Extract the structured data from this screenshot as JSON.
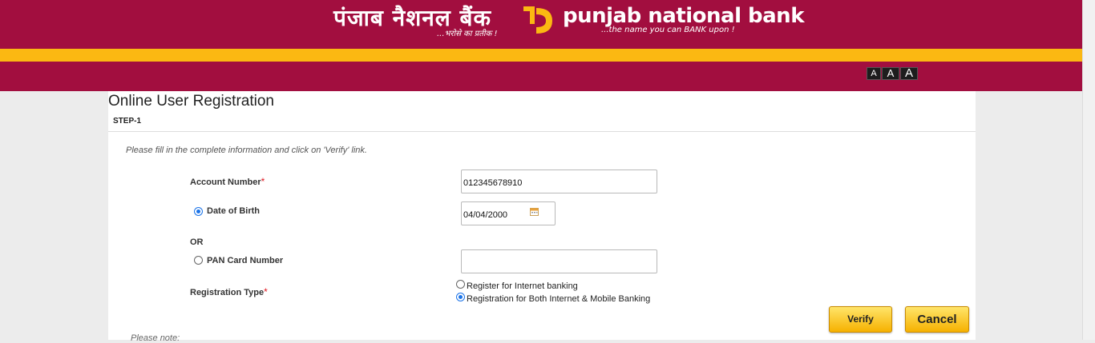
{
  "header": {
    "hindi_name": "पंजाब नैशनल बैंक",
    "hindi_tagline": "...भरोसे का प्रतीक !",
    "english_name": "punjab national bank",
    "english_tagline": "...the name you can BANK upon !",
    "font_sizer": [
      "A",
      "A",
      "A"
    ]
  },
  "page": {
    "title": "Online User Registration",
    "step": "STEP-1",
    "instructions": "Please fill in the complete information and click on 'Verify' link."
  },
  "form": {
    "account_number_label": "Account Number",
    "required_mark": "*",
    "account_number_value": "012345678910",
    "dob_label": "Date of Birth",
    "dob_value": "04/04/2000",
    "or_label": "OR",
    "pan_label": "PAN Card Number",
    "pan_value": "",
    "registration_type_label": "Registration Type",
    "registration_options": [
      "Register for Internet banking",
      "Registration for Both Internet & Mobile Banking"
    ],
    "selected_registration_option": 1,
    "selected_identity_option": "dob"
  },
  "buttons": {
    "verify": "Verify",
    "cancel": "Cancel"
  },
  "footer": {
    "note": "Please note:"
  },
  "colors": {
    "brand_maroon": "#a20e3f",
    "brand_yellow": "#fbb812",
    "radio_accent": "#1a73e8"
  }
}
